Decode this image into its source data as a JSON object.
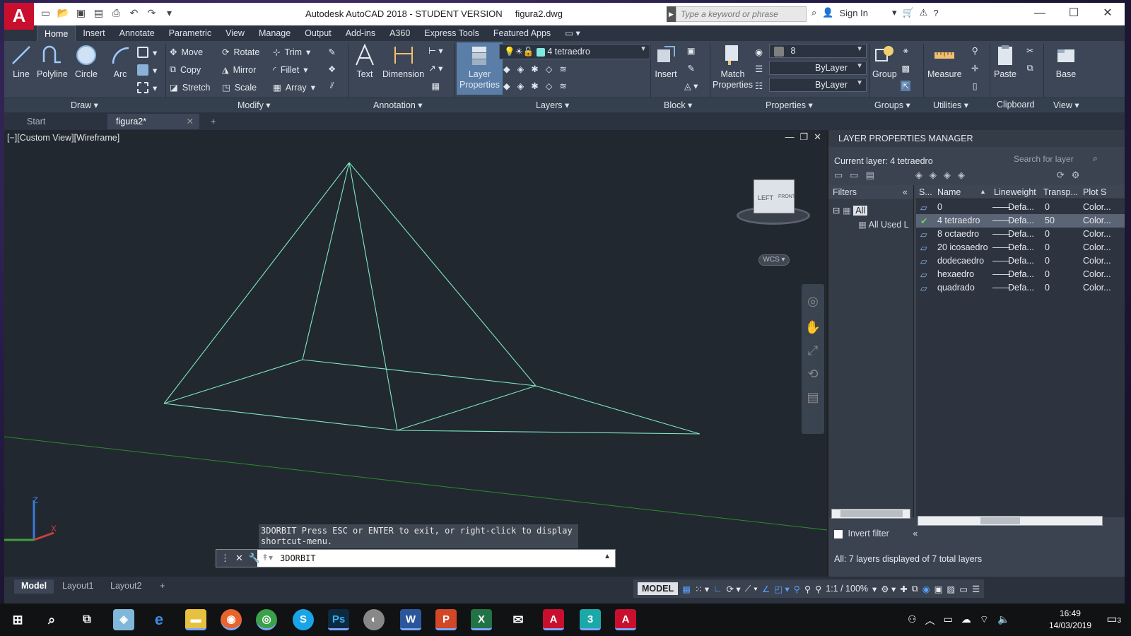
{
  "app": {
    "title": "Autodesk AutoCAD 2018 - STUDENT VERSION",
    "file": "figura2.dwg",
    "logo": "A",
    "search_placeholder": "Type a keyword or phrase",
    "sign_in": "Sign In",
    "accent": "#c8102e"
  },
  "menu": [
    "Home",
    "Insert",
    "Annotate",
    "Parametric",
    "View",
    "Manage",
    "Output",
    "Add-ins",
    "A360",
    "Express Tools",
    "Featured Apps"
  ],
  "ribbon": {
    "draw": {
      "line": "Line",
      "polyline": "Polyline",
      "circle": "Circle",
      "arc": "Arc"
    },
    "modify": {
      "move": "Move",
      "rotate": "Rotate",
      "trim": "Trim",
      "copy": "Copy",
      "mirror": "Mirror",
      "fillet": "Fillet",
      "stretch": "Stretch",
      "scale": "Scale",
      "array": "Array"
    },
    "annotation": {
      "text": "Text",
      "dimension": "Dimension"
    },
    "layers": {
      "layer_properties": "Layer Properties",
      "current_layer": "4 tetraedro",
      "layer_color": "#7fe8e0"
    },
    "block": {
      "insert": "Insert"
    },
    "properties": {
      "match": "Match Properties",
      "color_value": "8",
      "linetype": "ByLayer",
      "lineweight": "ByLayer"
    },
    "groups": {
      "group": "Group"
    },
    "utilities": {
      "measure": "Measure"
    },
    "clipboard": {
      "paste": "Paste"
    },
    "view": {
      "base": "Base"
    },
    "panel_labels": [
      "Draw",
      "Modify",
      "Annotation",
      "Layers",
      "Block",
      "Properties",
      "Groups",
      "Utilities",
      "Clipboard",
      "View"
    ]
  },
  "doc_tabs": {
    "start": "Start",
    "active": "figura2*"
  },
  "viewport": {
    "label": "[−][Custom View][Wireframe]",
    "viewcube_left": "LEFT",
    "viewcube_front": "FRONT",
    "wcs": "WCS",
    "wire_color": "#7fe8c0"
  },
  "command": {
    "history": "3DORBIT Press ESC or ENTER to exit, or right-click to display shortcut-menu.",
    "current": "3DORBIT"
  },
  "layer_manager": {
    "title": "LAYER PROPERTIES MANAGER",
    "current": "Current layer: 4 tetraedro",
    "search_placeholder": "Search for layer",
    "filters_label": "Filters",
    "filter_all": "All",
    "filter_used": "All Used L",
    "invert_filter": "Invert filter",
    "columns": [
      "S...",
      "Name",
      "Lineweight",
      "Transp...",
      "Plot S"
    ],
    "rows": [
      {
        "name": "0",
        "lineweight": "Defa...",
        "transp": "0",
        "plot": "Color..."
      },
      {
        "name": "4 tetraedro",
        "lineweight": "Defa...",
        "transp": "50",
        "plot": "Color..."
      },
      {
        "name": "8 octaedro",
        "lineweight": "Defa...",
        "transp": "0",
        "plot": "Color..."
      },
      {
        "name": "20 icosaedro",
        "lineweight": "Defa...",
        "transp": "0",
        "plot": "Color..."
      },
      {
        "name": "dodecaedro",
        "lineweight": "Defa...",
        "transp": "0",
        "plot": "Color..."
      },
      {
        "name": "hexaedro",
        "lineweight": "Defa...",
        "transp": "0",
        "plot": "Color..."
      },
      {
        "name": "quadrado",
        "lineweight": "Defa...",
        "transp": "0",
        "plot": "Color..."
      }
    ],
    "status": "All: 7 layers displayed of 7 total layers"
  },
  "layout_tabs": [
    "Model",
    "Layout1",
    "Layout2"
  ],
  "statusbar": {
    "model": "MODEL",
    "scale": "1:1 / 100%"
  },
  "taskbar": {
    "time": "16:49",
    "date": "14/03/2019",
    "notifications": "3"
  }
}
